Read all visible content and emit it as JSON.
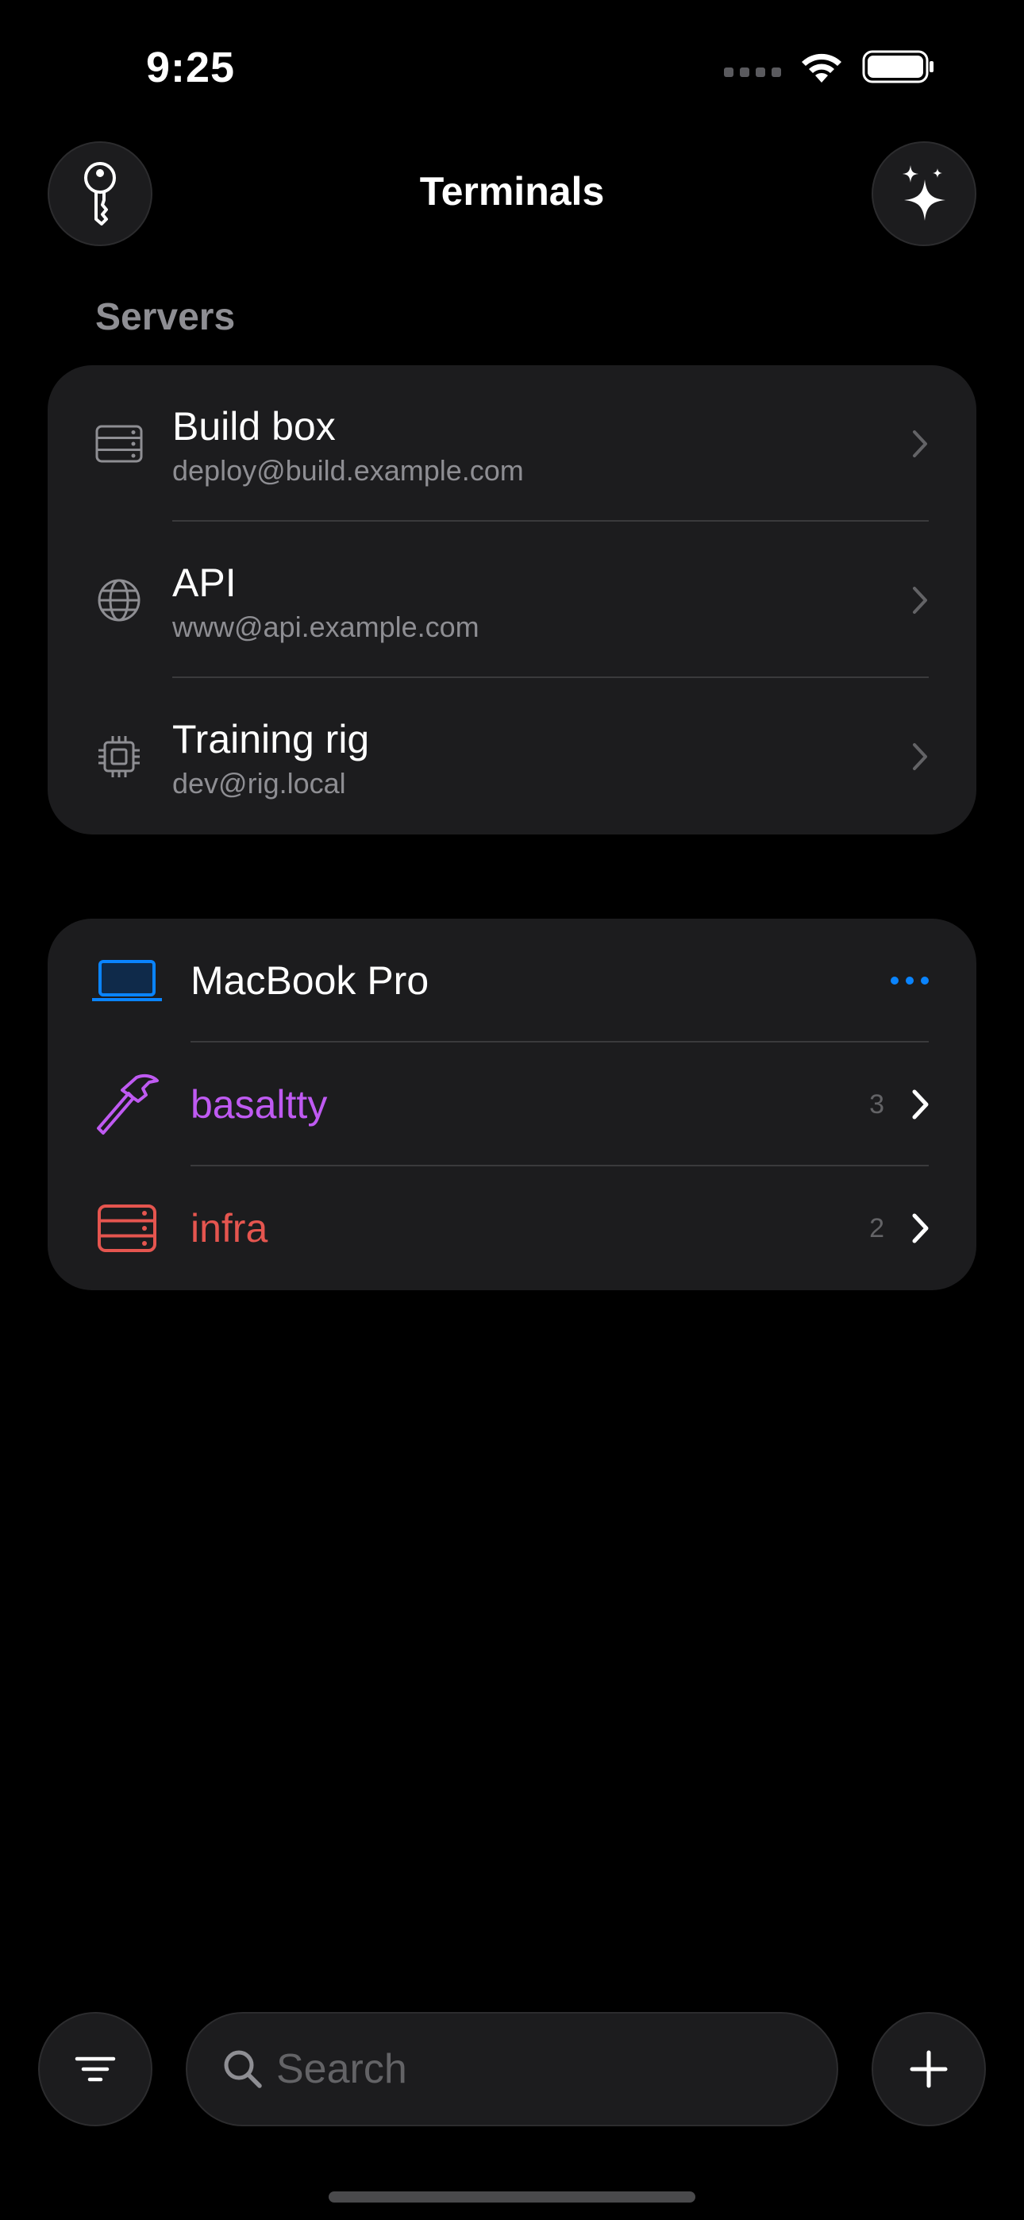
{
  "status_bar": {
    "time": "9:25"
  },
  "header": {
    "title": "Terminals"
  },
  "servers": {
    "section_label": "Servers",
    "items": [
      {
        "name": "Build box",
        "address": "deploy@build.example.com",
        "icon": "server-rack-icon"
      },
      {
        "name": "API",
        "address": "www@api.example.com",
        "icon": "globe-icon"
      },
      {
        "name": "Training rig",
        "address": "dev@rig.local",
        "icon": "cpu-chip-icon"
      }
    ]
  },
  "device": {
    "name": "MacBook Pro",
    "icon": "laptop-icon",
    "folders": [
      {
        "name": "basaltty",
        "count": "3",
        "icon": "hammer-icon",
        "color": "#bf5af2"
      },
      {
        "name": "infra",
        "count": "2",
        "icon": "server-rack-icon",
        "color": "#e5554f"
      }
    ]
  },
  "search": {
    "placeholder": "Search"
  },
  "colors": {
    "accent": "#0a84ff",
    "background": "#000000",
    "card": "#1c1c1e"
  }
}
